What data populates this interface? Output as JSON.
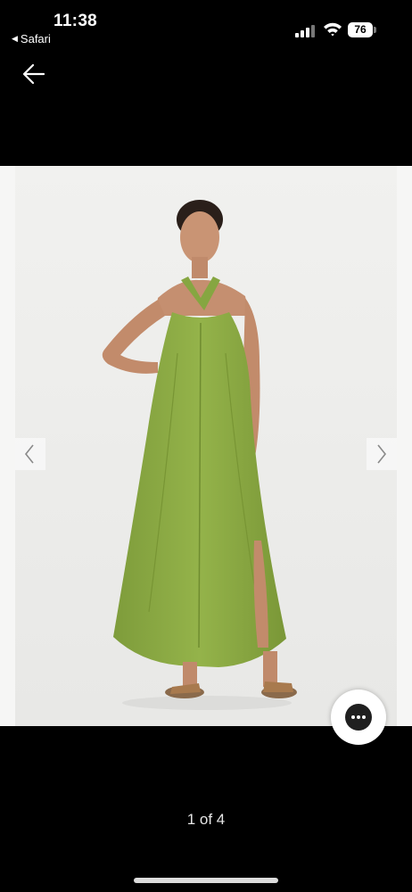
{
  "status_bar": {
    "time": "11:38",
    "back_to_app": "Safari",
    "battery_level": "76",
    "signal_bars_active": 3,
    "signal_bars_total": 4
  },
  "nav": {
    "back_icon": "arrow-left-icon"
  },
  "gallery": {
    "image_description_icon": "product-photo",
    "prev_icon": "chevron-left-icon",
    "next_icon": "chevron-right-icon",
    "page_counter": "1 of 4"
  },
  "actions": {
    "more_icon": "ellipsis-icon"
  },
  "colors": {
    "background": "#000000",
    "photo_background": "#eeeeec",
    "dress": "#8eae45",
    "sandals": "#a87a4e"
  }
}
